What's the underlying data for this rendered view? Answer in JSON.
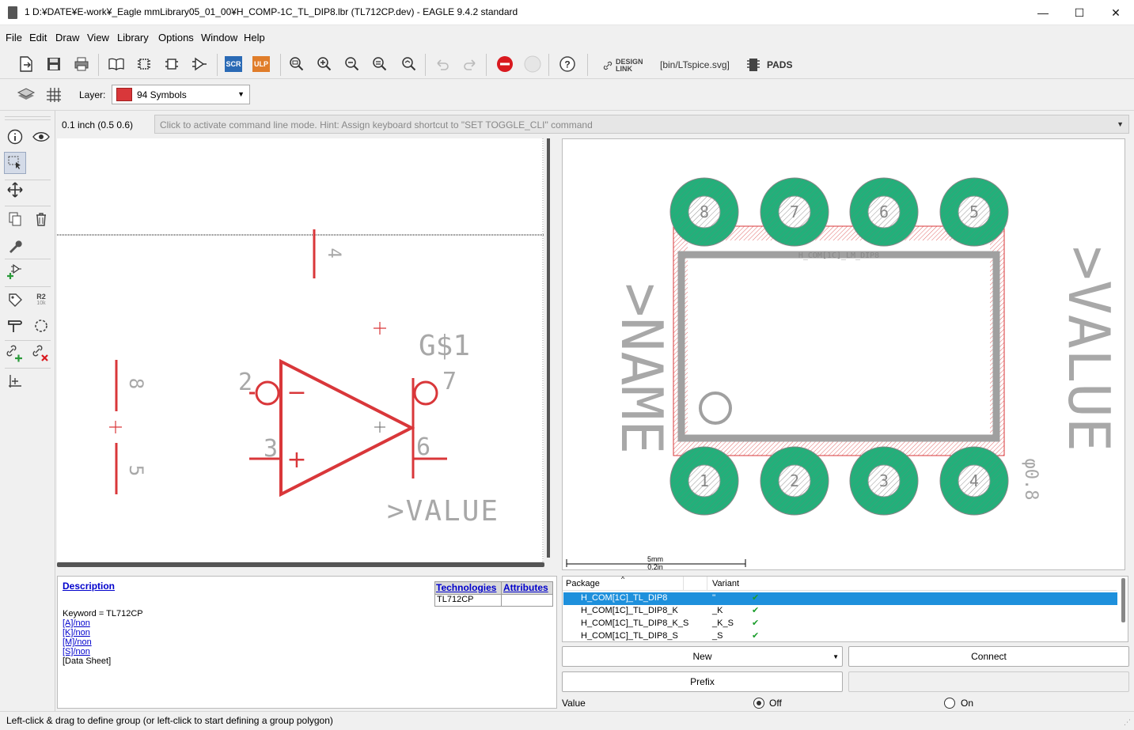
{
  "window": {
    "title": "1 D:¥DATE¥E-work¥_Eagle mmLibrary05_01_00¥H_COMP-1C_TL_DIP8.lbr (TL712CP.dev) - EAGLE 9.4.2 standard",
    "minimize": "—",
    "maximize": "☐",
    "close": "✕"
  },
  "menu": [
    "File",
    "Edit",
    "Draw",
    "View",
    "Library",
    "Options",
    "Window",
    "Help"
  ],
  "toolbar": {
    "scr_label": "SCR",
    "ulp_label": "ULP",
    "design_link_line1": "DESIGN",
    "design_link_line2": "LINK",
    "ltspice_label": "[bin/LTspice.svg]",
    "pads_label": "PADS",
    "help_label": "?"
  },
  "layer": {
    "label": "Layer:",
    "selected": "94 Symbols",
    "color": "#d9373a"
  },
  "coordinates": "0.1 inch (0.5 0.6)",
  "command_line": {
    "placeholder": "Click to activate command line mode. Hint: Assign keyboard shortcut to \"SET TOGGLE_CLI\" command"
  },
  "left_tools": {
    "r2_label": "R2",
    "r2_sub": "10k"
  },
  "symbol": {
    "gate_name": "G$1",
    "value_label": ">VALUE",
    "pin_minus_in": "2",
    "pin_plus_in": "3",
    "pin_out_comp": "7",
    "pin_out": "6",
    "pin_top": "4",
    "pin_left_top": "8",
    "pin_left_bottom": "5",
    "minus_sign": "−",
    "plus_sign": "+"
  },
  "package": {
    "name_label": ">NAME",
    "value_label": ">VALUE",
    "outline_label": "H_COM[1C]_LM_DIP8",
    "drill_label": "φ0.8",
    "scale_top": "5mm",
    "scale_bottom": "0.2in",
    "pad_numbers_top": [
      "8",
      "7",
      "6",
      "5"
    ],
    "pad_numbers_bottom": [
      "1",
      "2",
      "3",
      "4"
    ]
  },
  "description": {
    "heading": "Description",
    "keyword": "Keyword = TL712CP",
    "links": [
      "[A]/non",
      "[K]/non",
      "[M]/non",
      "[S]/non"
    ],
    "datasheet": "[Data Sheet]",
    "tabs": [
      "Technologies",
      "Attributes"
    ],
    "technology_value": "TL712CP"
  },
  "package_table": {
    "headers": [
      "Package",
      "Variant"
    ],
    "rows": [
      {
        "package": "H_COM[1C]_TL_DIP8",
        "variant": "''",
        "check": "✔",
        "selected": true
      },
      {
        "package": "H_COM[1C]_TL_DIP8_K",
        "variant": "_K",
        "check": "✔",
        "selected": false
      },
      {
        "package": "H_COM[1C]_TL_DIP8_K_S",
        "variant": "_K_S",
        "check": "✔",
        "selected": false
      },
      {
        "package": "H_COM[1C]_TL_DIP8_S",
        "variant": "_S",
        "check": "✔",
        "selected": false
      }
    ]
  },
  "buttons": {
    "new": "New",
    "connect": "Connect",
    "prefix": "Prefix"
  },
  "value_option": {
    "label": "Value",
    "off": "Off",
    "on": "On",
    "selected": "Off"
  },
  "status": "Left-click & drag to define group (or left-click to start defining a group polygon)",
  "colors": {
    "symbol_red": "#d9373a",
    "pad_green": "#22b07a",
    "outline_gray": "#a0a0a0",
    "selection_blue": "#1e90dc"
  }
}
